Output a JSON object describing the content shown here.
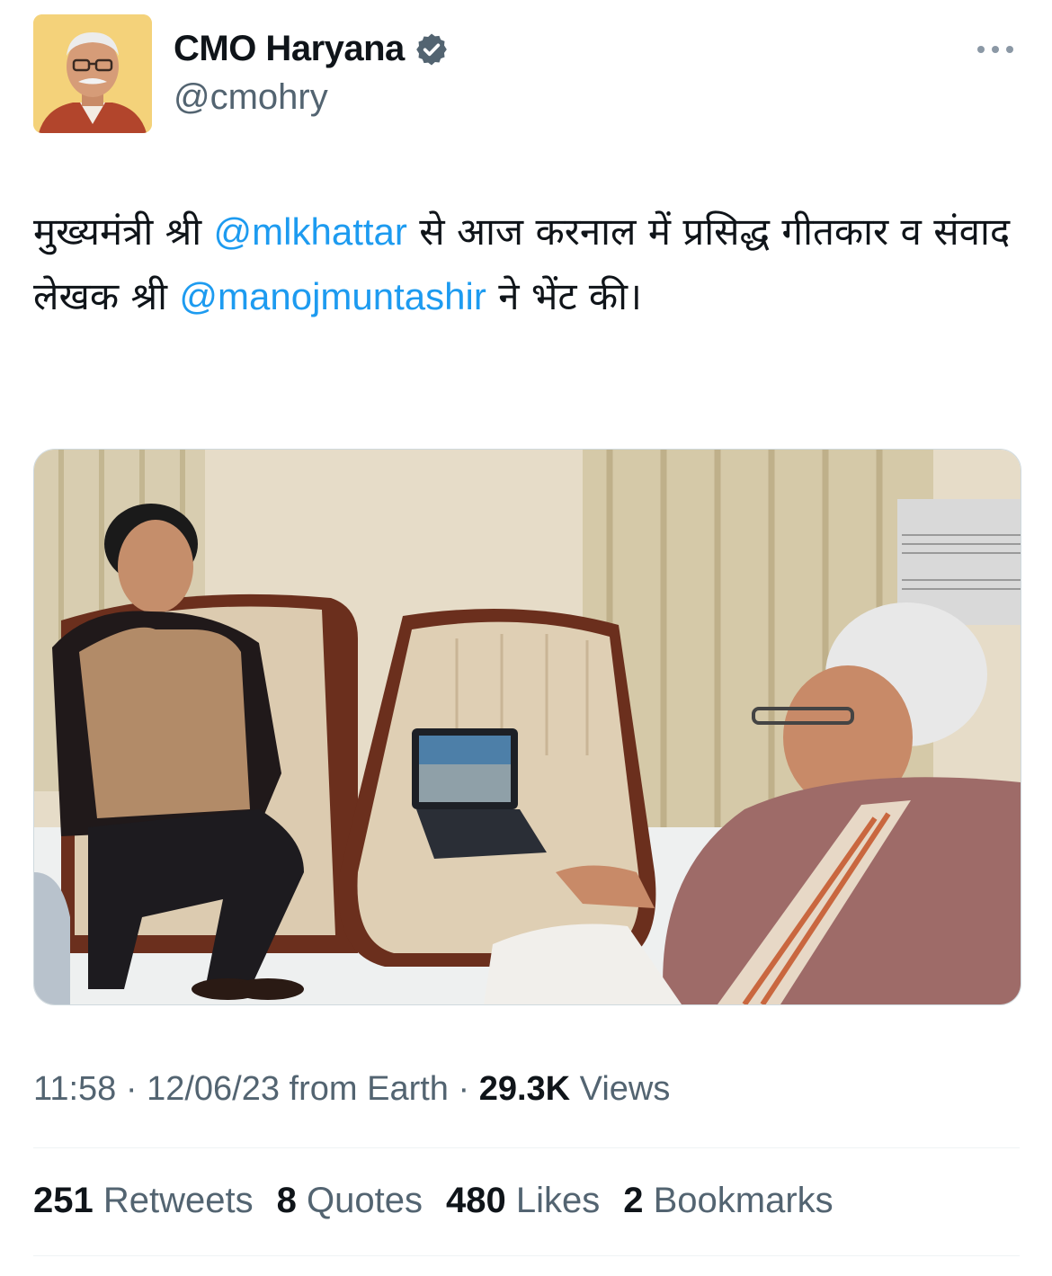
{
  "author": {
    "display_name": "CMO Haryana",
    "handle": "@cmohry",
    "verified": true,
    "verified_color": "#0f1419"
  },
  "tweet": {
    "text_part1": "मुख्यमंत्री श्री ",
    "mention1": "@mlkhattar",
    "text_part2": " से आज करनाल में प्रसिद्ध गीतकार व संवाद लेखक श्री ",
    "mention2": "@manojmuntashir",
    "text_part3": " ने भेंट की।",
    "mention_color": "#1d9bf0"
  },
  "meta": {
    "time": "11:58",
    "sep1": " · ",
    "date": "12/06/23",
    "source": " from Earth",
    "sep2": " · ",
    "views_count": "29.3K",
    "views_label": " Views"
  },
  "stats": [
    {
      "count": "251",
      "label": "Retweets"
    },
    {
      "count": "8",
      "label": "Quotes"
    },
    {
      "count": "480",
      "label": "Likes"
    },
    {
      "count": "2",
      "label": "Bookmarks"
    }
  ],
  "icons": {
    "verified": "verified-badge-icon",
    "more": "more-options-icon"
  }
}
